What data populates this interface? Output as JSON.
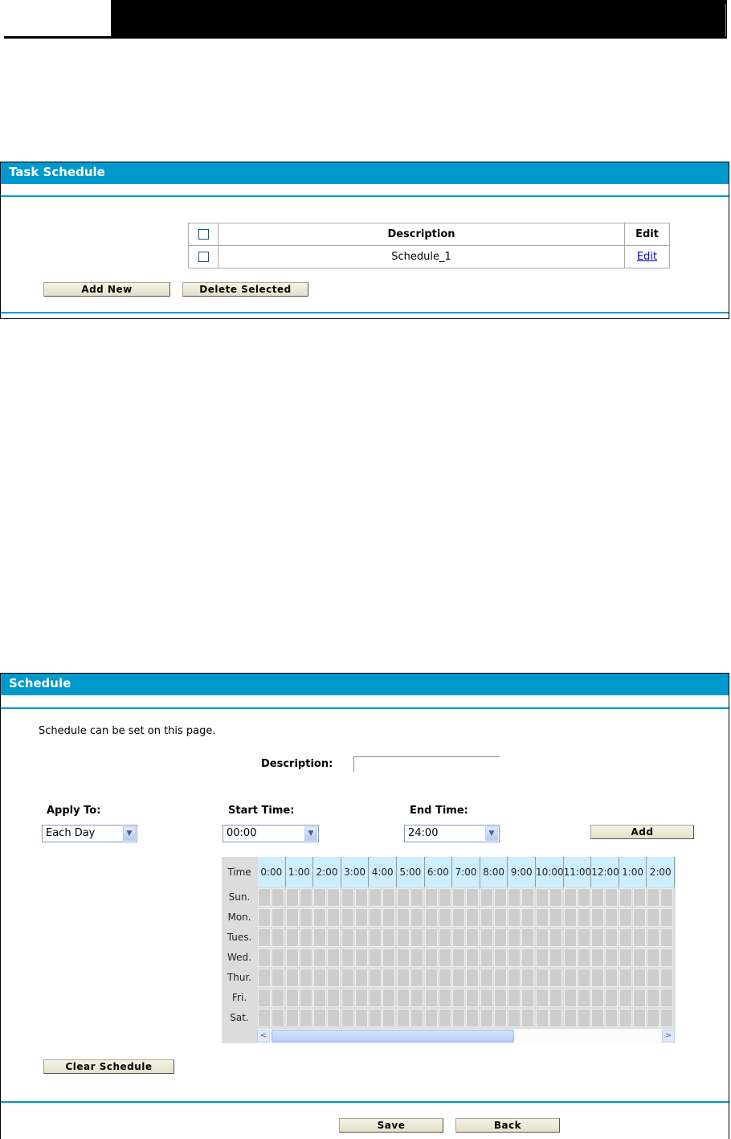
{
  "task_schedule": {
    "title": "Task Schedule",
    "columns": [
      "Description",
      "Edit"
    ],
    "rows": [
      {
        "description": "Schedule_1",
        "edit": "Edit"
      }
    ],
    "add_new": "Add New",
    "delete_selected": "Delete Selected"
  },
  "schedule": {
    "title": "Schedule",
    "intro": "Schedule can be set on this page.",
    "description_label": "Description:",
    "description_value": "",
    "apply_to_label": "Apply To:",
    "apply_to_value": "Each Day",
    "start_time_label": "Start Time:",
    "start_time_value": "00:00",
    "end_time_label": "End Time:",
    "end_time_value": "24:00",
    "add": "Add",
    "time_header": "Time",
    "hours": [
      "0:00",
      "1:00",
      "2:00",
      "3:00",
      "4:00",
      "5:00",
      "6:00",
      "7:00",
      "8:00",
      "9:00",
      "10:00",
      "11:00",
      "12:00",
      "1:00",
      "2:00"
    ],
    "days": [
      "Sun.",
      "Mon.",
      "Tues.",
      "Wed.",
      "Thur.",
      "Fri.",
      "Sat."
    ],
    "clear": "Clear Schedule",
    "save": "Save",
    "back": "Back"
  },
  "colors": {
    "accent": "#0099cc",
    "header_cell": "#cceeff"
  }
}
